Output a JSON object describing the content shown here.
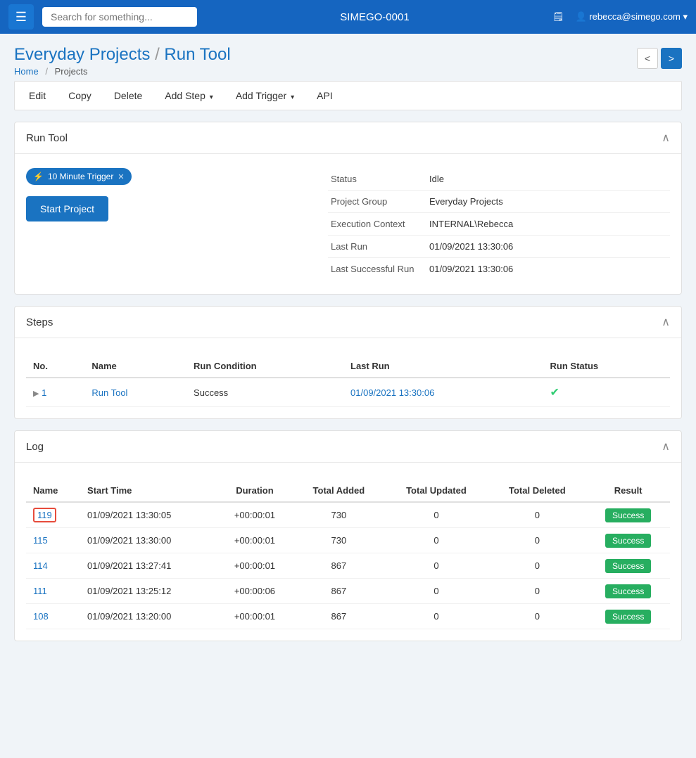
{
  "app": {
    "title": "SIMEGO-0001",
    "search_placeholder": "Search for something...",
    "user": "rebecca@simego.com"
  },
  "breadcrumb": {
    "home": "Home",
    "separator": "/",
    "projects": "Projects"
  },
  "page": {
    "project_group": "Everyday Projects",
    "page_name": "Run Tool",
    "title_separator": "/"
  },
  "toolbar": {
    "edit": "Edit",
    "copy": "Copy",
    "delete": "Delete",
    "add_step": "Add Step",
    "add_trigger": "Add Trigger",
    "api": "API"
  },
  "run_tool_section": {
    "title": "Run Tool",
    "trigger_badge": "10 Minute Trigger",
    "start_project_btn": "Start Project",
    "status_label": "Status",
    "status_value": "Idle",
    "project_group_label": "Project Group",
    "project_group_value": "Everyday Projects",
    "execution_context_label": "Execution Context",
    "execution_context_value": "INTERNAL\\Rebecca",
    "last_run_label": "Last Run",
    "last_run_value": "01/09/2021 13:30:06",
    "last_successful_run_label": "Last Successful Run",
    "last_successful_run_value": "01/09/2021 13:30:06"
  },
  "steps_section": {
    "title": "Steps",
    "columns": [
      "No.",
      "Name",
      "Run Condition",
      "Last Run",
      "Run Status"
    ],
    "rows": [
      {
        "no": "1",
        "name": "Run Tool",
        "run_condition": "Success",
        "last_run": "01/09/2021\n13:30:06",
        "run_status": "✔"
      }
    ]
  },
  "log_section": {
    "title": "Log",
    "columns": [
      "Name",
      "Start Time",
      "Duration",
      "Total Added",
      "Total Updated",
      "Total Deleted",
      "Result"
    ],
    "rows": [
      {
        "name": "119",
        "start_time": "01/09/2021 13:30:05",
        "duration": "+00:00:01",
        "total_added": "730",
        "total_updated": "0",
        "total_deleted": "0",
        "result": "Success",
        "selected": true
      },
      {
        "name": "115",
        "start_time": "01/09/2021 13:30:00",
        "duration": "+00:00:01",
        "total_added": "730",
        "total_updated": "0",
        "total_deleted": "0",
        "result": "Success",
        "selected": false
      },
      {
        "name": "114",
        "start_time": "01/09/2021 13:27:41",
        "duration": "+00:00:01",
        "total_added": "867",
        "total_updated": "0",
        "total_deleted": "0",
        "result": "Success",
        "selected": false
      },
      {
        "name": "111",
        "start_time": "01/09/2021 13:25:12",
        "duration": "+00:00:06",
        "total_added": "867",
        "total_updated": "0",
        "total_deleted": "0",
        "result": "Success",
        "selected": false
      },
      {
        "name": "108",
        "start_time": "01/09/2021 13:20:00",
        "duration": "+00:00:01",
        "total_added": "867",
        "total_updated": "0",
        "total_deleted": "0",
        "result": "Success",
        "selected": false
      }
    ]
  }
}
